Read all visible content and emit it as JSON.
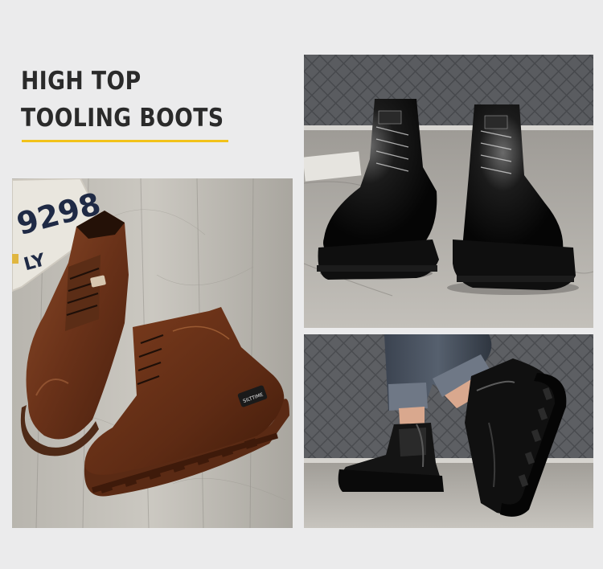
{
  "heading": {
    "line1": "HIGH TOP",
    "line2": "TOOLING BOOTS"
  },
  "colors": {
    "accent_underline": "#f2c21a",
    "heading_text": "#2a2a2a",
    "background": "#ebebec"
  },
  "photos": [
    {
      "name": "brown-boots-pair-on-wood",
      "sign_text": "9298",
      "sign_text2": "LY",
      "brand_label": "SILTTIME"
    },
    {
      "name": "black-boots-pair-front"
    },
    {
      "name": "black-boots-worn-walking"
    }
  ]
}
